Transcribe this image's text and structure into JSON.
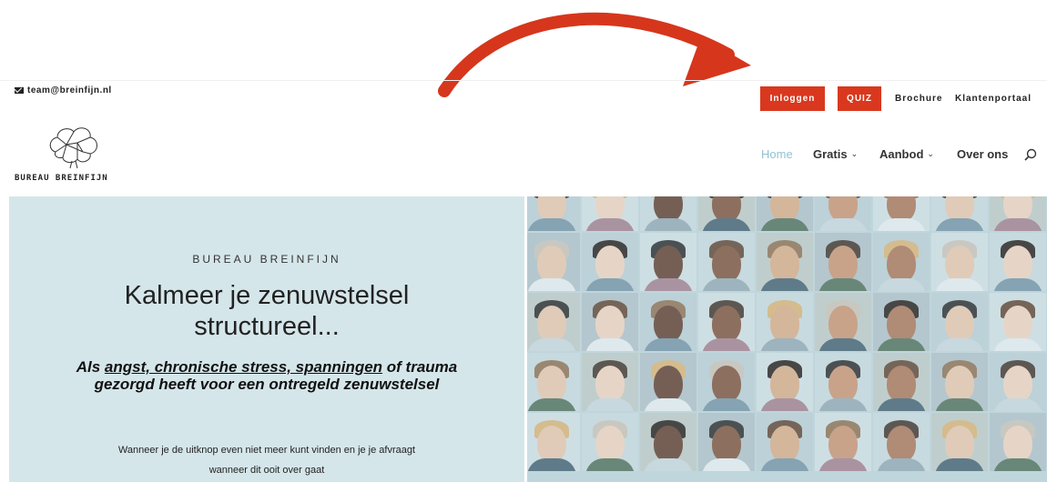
{
  "topbar": {
    "email": "team@breinfijn.nl",
    "buttons": {
      "login": "Inloggen",
      "quiz": "QUIZ"
    },
    "links": {
      "brochure": "Brochure",
      "portaal": "Klantenportaal"
    }
  },
  "brand": {
    "name": "BUREAU BREINFIJN"
  },
  "nav": {
    "items": [
      {
        "label": "Home",
        "active": true
      },
      {
        "label": "Gratis",
        "dropdown": true
      },
      {
        "label": "Aanbod",
        "dropdown": true
      },
      {
        "label": "Over ons"
      }
    ]
  },
  "hero": {
    "kicker": "BUREAU BREINFIJN",
    "title_line1": "Kalmeer je zenuwstelsel",
    "title_line2": "structureel...",
    "sub": {
      "prefix": "Als ",
      "underlined": "angst, chronische stress, spanningen",
      "rest": " of trauma gezorgd heeft voor een ontregeld zenuwstelsel"
    },
    "body_line1": "Wanneer je de uitknop even niet meer kunt vinden en je je afvraagt",
    "body_line2": "wanneer dit ooit over gaat"
  },
  "colors": {
    "accent_red": "#d9381e",
    "hero_bg": "#d5e6ea",
    "nav_active": "#8fc3d4",
    "arrow": "#d6361c"
  },
  "icons": [
    "mail-icon",
    "brain-logo-icon",
    "chevron-down-icon",
    "search-icon",
    "arrow-annotation"
  ]
}
